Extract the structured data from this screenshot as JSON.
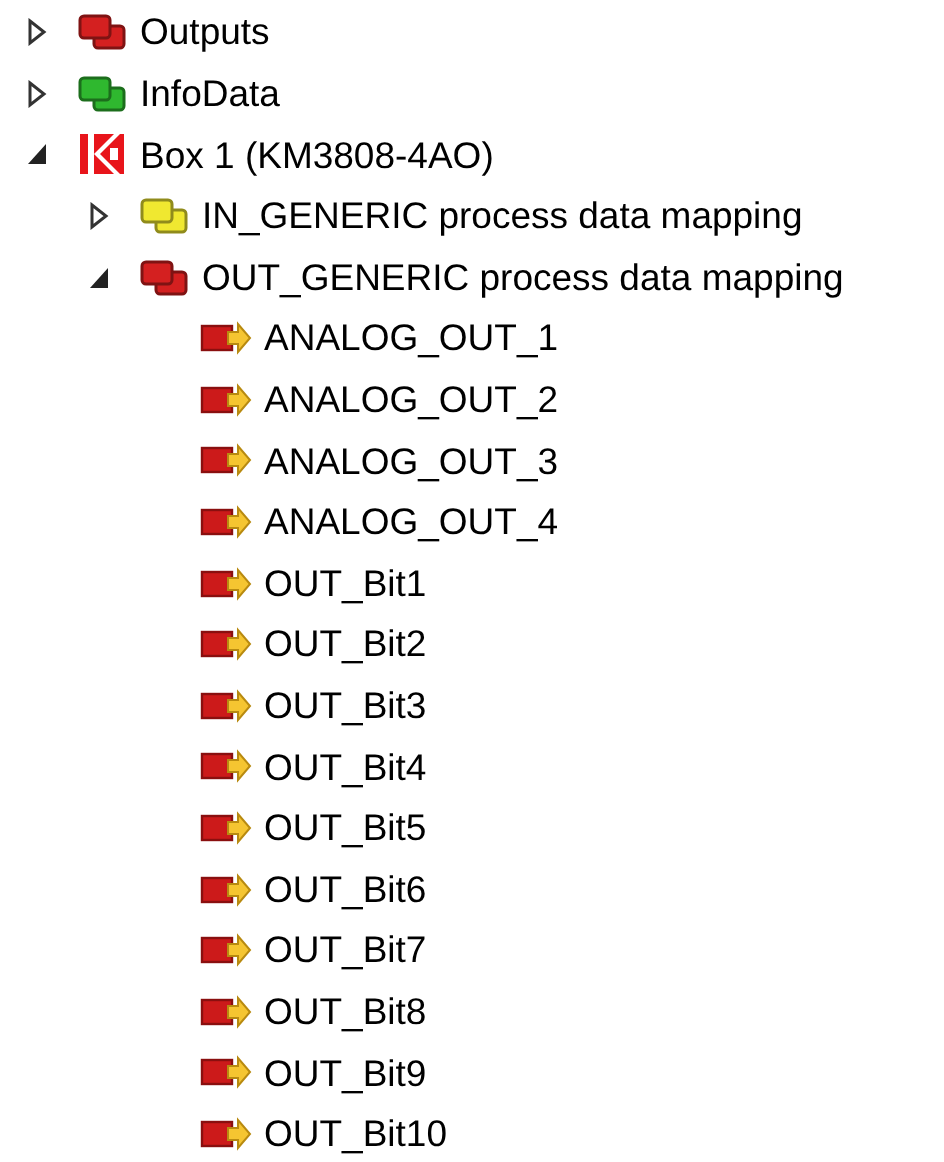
{
  "tree": [
    {
      "label": "Outputs",
      "kind": "group",
      "color": "#d42020",
      "expanded": false
    },
    {
      "label": "InfoData",
      "kind": "group",
      "color": "#2fb82f",
      "expanded": false
    },
    {
      "label": "Box 1 (KM3808-4AO)",
      "kind": "device",
      "expanded": true,
      "children": [
        {
          "label": "IN_GENERIC process data mapping",
          "kind": "group",
          "color": "#f0e830",
          "expanded": false
        },
        {
          "label": "OUT_GENERIC process data mapping",
          "kind": "group",
          "color": "#d42020",
          "expanded": true,
          "children": [
            {
              "label": "ANALOG_OUT_1",
              "kind": "variable"
            },
            {
              "label": "ANALOG_OUT_2",
              "kind": "variable"
            },
            {
              "label": "ANALOG_OUT_3",
              "kind": "variable"
            },
            {
              "label": "ANALOG_OUT_4",
              "kind": "variable"
            },
            {
              "label": "OUT_Bit1",
              "kind": "variable"
            },
            {
              "label": "OUT_Bit2",
              "kind": "variable"
            },
            {
              "label": "OUT_Bit3",
              "kind": "variable"
            },
            {
              "label": "OUT_Bit4",
              "kind": "variable"
            },
            {
              "label": "OUT_Bit5",
              "kind": "variable"
            },
            {
              "label": "OUT_Bit6",
              "kind": "variable"
            },
            {
              "label": "OUT_Bit7",
              "kind": "variable"
            },
            {
              "label": "OUT_Bit8",
              "kind": "variable"
            },
            {
              "label": "OUT_Bit9",
              "kind": "variable"
            },
            {
              "label": "OUT_Bit10",
              "kind": "variable"
            }
          ]
        }
      ]
    }
  ]
}
